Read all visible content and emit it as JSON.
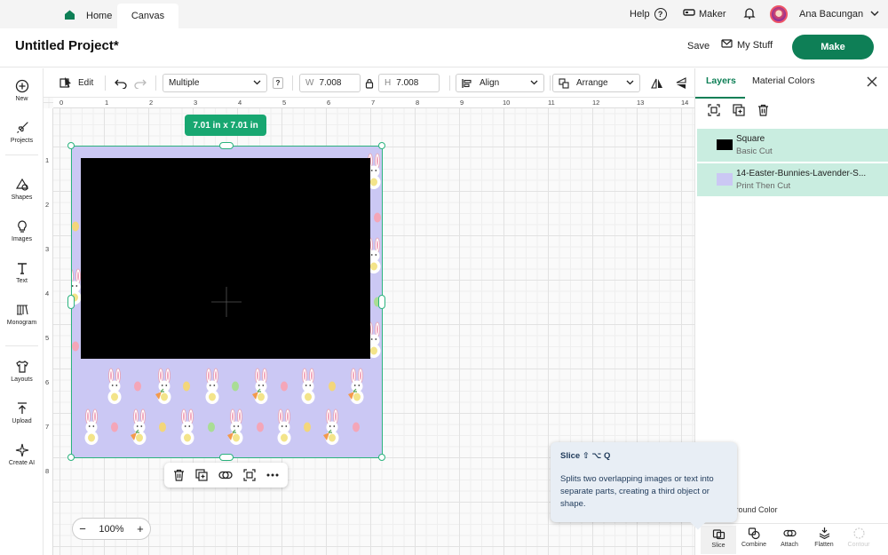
{
  "top_nav": {
    "home": "Home",
    "canvas": "Canvas",
    "help": "Help",
    "help_glyph": "?",
    "maker": "Maker",
    "user": "Ana Bacungan"
  },
  "header": {
    "project_title": "Untitled Project*",
    "save": "Save",
    "my_stuff": "My Stuff",
    "make": "Make"
  },
  "sidebar": {
    "items": [
      {
        "label": "New",
        "icon": "plus-circle-icon"
      },
      {
        "label": "Projects",
        "icon": "rocket-icon"
      },
      {
        "label": "Shapes",
        "icon": "shapes-icon"
      },
      {
        "label": "Images",
        "icon": "lightbulb-icon"
      },
      {
        "label": "Text",
        "icon": "text-icon"
      },
      {
        "label": "Monogram",
        "icon": "monogram-icon"
      },
      {
        "label": "Layouts",
        "icon": "shirt-icon"
      },
      {
        "label": "Upload",
        "icon": "upload-icon"
      },
      {
        "label": "Create AI",
        "icon": "sparkle-icon"
      }
    ]
  },
  "toolbar": {
    "edit": "Edit",
    "operation": "Multiple",
    "help_glyph": "?",
    "width_label": "W",
    "width": "7.008",
    "height_label": "H",
    "height": "7.008",
    "align": "Align",
    "arrange": "Arrange"
  },
  "ruler": {
    "top": [
      "0",
      "1",
      "2",
      "3",
      "4",
      "5",
      "6",
      "7",
      "8",
      "9",
      "10",
      "11",
      "12",
      "13",
      "14"
    ],
    "left": [
      "1",
      "2",
      "3",
      "4",
      "5",
      "6",
      "7",
      "8"
    ]
  },
  "canvas": {
    "size_badge": "7.01  in x 7.01  in",
    "zoom": "100%",
    "zoom_minus": "−",
    "zoom_plus": "+",
    "pattern_colors": {
      "background": "#cbc8f4",
      "square": "#000000"
    }
  },
  "tooltip": {
    "title": "Slice ⇧ ⌥ Q",
    "body": "Splits two overlapping images or text into separate parts, creating a third object or shape."
  },
  "right_panel": {
    "tabs": [
      "Layers",
      "Material Colors"
    ],
    "layers": [
      {
        "name": "Square",
        "type": "Basic Cut",
        "swatch": "#000000"
      },
      {
        "name": "14-Easter-Bunnies-Lavender-S...",
        "type": "Print Then Cut",
        "swatch": "#cbc8f4"
      }
    ],
    "background_color": "kground Color",
    "bottom_actions": [
      "Slice",
      "Combine",
      "Attach",
      "Flatten",
      "Contour"
    ]
  },
  "colors": {
    "accent": "#0e7f56",
    "selection": "#2bb37e",
    "layer_highlight": "#c9ede0"
  }
}
